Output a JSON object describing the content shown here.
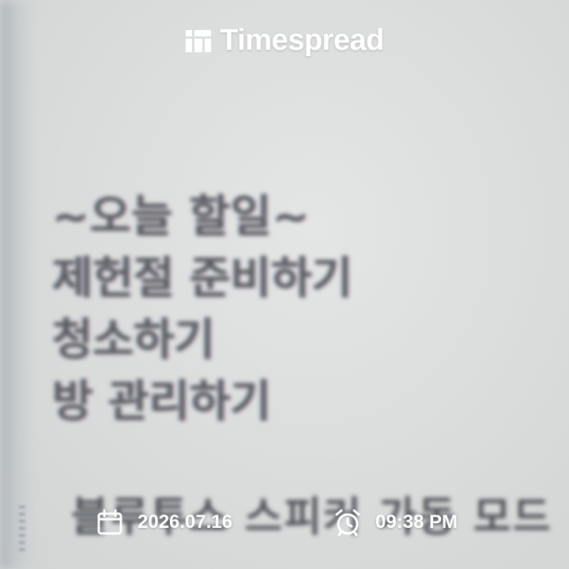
{
  "watermark": {
    "brand_name": "Timespread",
    "brand_icon": "timespread-logo-icon",
    "date": "2026.07.16",
    "date_icon": "calendar-icon",
    "time": "09:38 PM",
    "time_icon": "alarm-clock-icon",
    "color": "#ffffff"
  },
  "photo": {
    "note_lines": [
      "~오늘 할일~",
      "제헌절 준비하기",
      "청소하기",
      "방 관리하기"
    ],
    "bottom_line": "블루투스 스피커 가동 모드",
    "text_color": "#5a5d63",
    "background_color": "#dcdede"
  }
}
